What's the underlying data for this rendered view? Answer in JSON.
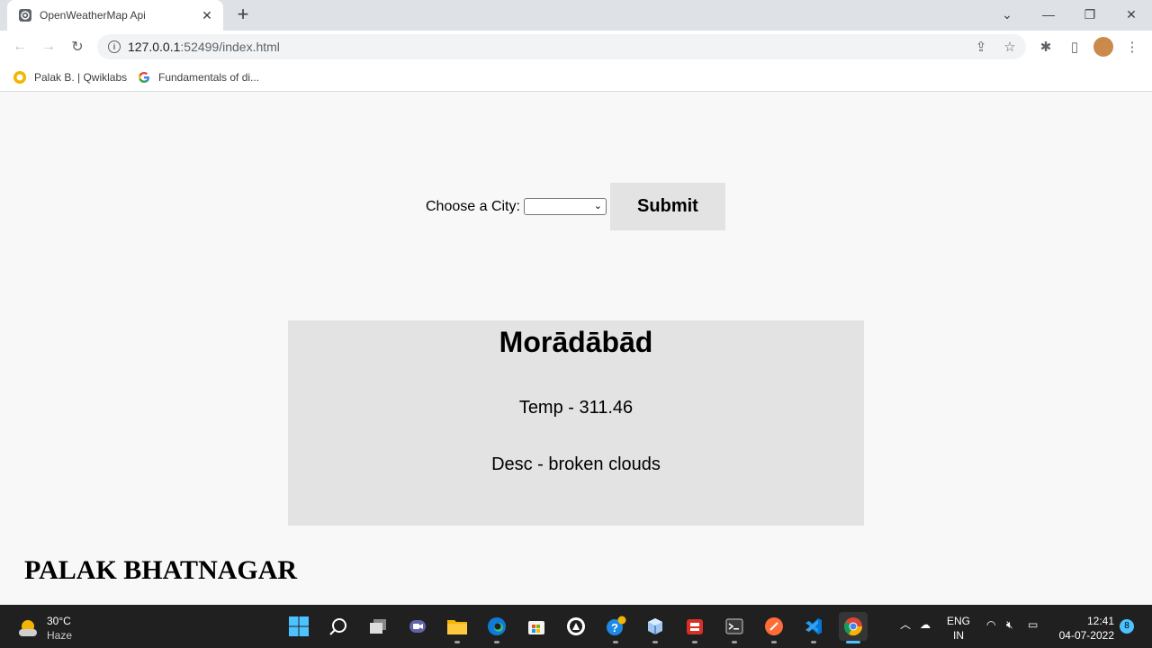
{
  "browser": {
    "tab_title": "OpenWeatherMap Api",
    "url_host": "127.0.0.1",
    "url_rest": ":52499/index.html",
    "bookmarks": [
      {
        "label": "Palak B. | Qwiklabs",
        "icon": "qwiklabs-icon"
      },
      {
        "label": "Fundamentals of di...",
        "icon": "google-icon"
      }
    ]
  },
  "form": {
    "label": "Choose a City:",
    "select_value": "",
    "submit_label": "Submit"
  },
  "weather_card": {
    "city": "Morādābād",
    "temp": "Temp - 311.46",
    "desc": "Desc - broken clouds"
  },
  "author": "PALAK BHATNAGAR",
  "taskbar": {
    "weather_temp": "30°C",
    "weather_desc": "Haze",
    "lang_top": "ENG",
    "lang_bottom": "IN",
    "time": "12:41",
    "date": "04-07-2022",
    "notification_count": "8"
  },
  "colors": {
    "page_bg": "#f8f8f8",
    "card_bg": "#e3e3e3",
    "taskbar_bg": "#202020",
    "accent": "#4cc2ff"
  }
}
